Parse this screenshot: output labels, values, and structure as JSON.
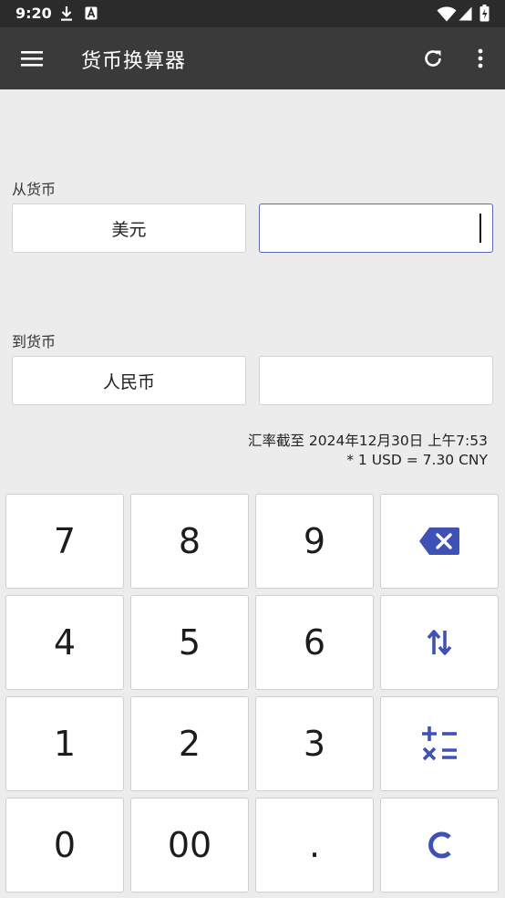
{
  "status_bar": {
    "time": "9:20",
    "icons": [
      "download-icon",
      "app-badge-icon",
      "wifi-icon",
      "signal-icon",
      "battery-charging-icon"
    ]
  },
  "app_bar": {
    "title": "货币换算器",
    "icons": [
      "menu-icon",
      "refresh-icon",
      "more-vert-icon"
    ]
  },
  "from": {
    "label": "从货币",
    "currency": "美元",
    "amount": ""
  },
  "to": {
    "label": "到货币",
    "currency": "人民币",
    "amount": ""
  },
  "rate": {
    "updated": "汇率截至 2024年12月30日 上午7:53",
    "conversion": "* 1 USD = 7.30 CNY"
  },
  "keypad": {
    "keys": [
      "7",
      "8",
      "9",
      "4",
      "5",
      "6",
      "1",
      "2",
      "3",
      "0",
      "00",
      "."
    ],
    "action_icons": [
      "backspace-icon",
      "swap-icon",
      "calculator-icon",
      "clear-icon"
    ],
    "accent_color": "#3f51b5"
  },
  "colors": {
    "status_bar": "#2b2b2b",
    "app_bar": "#3a3a3a",
    "background": "#ececec",
    "accent": "#3f51b5"
  }
}
